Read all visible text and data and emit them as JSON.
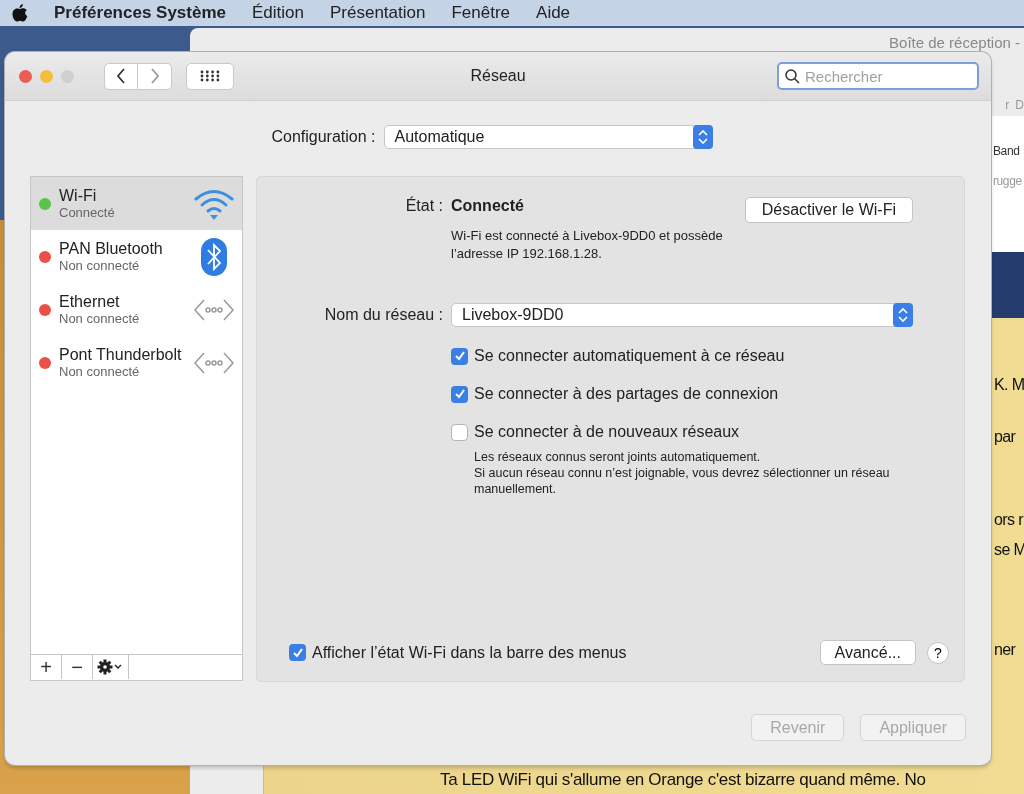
{
  "menu_bar": {
    "app": "Préférences Système",
    "items": [
      "Édition",
      "Présentation",
      "Fenêtre",
      "Aide"
    ]
  },
  "background_window": {
    "title": "Boîte de réception -",
    "toolbar_fragments": [
      "r",
      "D"
    ],
    "list_fragments": [
      "Band",
      "rugge"
    ],
    "message_fragments": [
      "K. M",
      "par",
      "ors r",
      "se M",
      "ner"
    ],
    "message_last_line": "Ta LED WiFi qui s'allume en Orange c'est bizarre quand même. No"
  },
  "window": {
    "title": "Réseau",
    "search": {
      "placeholder": "Rechercher"
    }
  },
  "configuration": {
    "label": "Configuration :",
    "value": "Automatique"
  },
  "services": [
    {
      "name": "Wi-Fi",
      "status": "Connecté",
      "color": "#5ac44a",
      "selected": true,
      "kind": "wifi"
    },
    {
      "name": "PAN Bluetooth",
      "status": "Non connecté",
      "color": "#e9504a",
      "selected": false,
      "kind": "bluetooth"
    },
    {
      "name": "Ethernet",
      "status": "Non connecté",
      "color": "#e9504a",
      "selected": false,
      "kind": "wired"
    },
    {
      "name": "Pont Thunderbolt",
      "status": "Non connecté",
      "color": "#e9504a",
      "selected": false,
      "kind": "wired"
    }
  ],
  "service_toolbar": {
    "add": "+",
    "remove": "−"
  },
  "status": {
    "label": "État :",
    "value": "Connecté",
    "toggle_button": "Désactiver le Wi-Fi",
    "description": "Wi-Fi est connecté à Livebox-9DD0 et possède l’adresse IP 192.168.1.28."
  },
  "network_name": {
    "label": "Nom du réseau :",
    "value": "Livebox-9DD0"
  },
  "options": [
    {
      "label": "Se connecter automatiquement à ce réseau",
      "checked": true
    },
    {
      "label": "Se connecter à des partages de connexion",
      "checked": true
    },
    {
      "label": "Se connecter à de nouveaux réseaux",
      "checked": false
    }
  ],
  "options_note": [
    "Les réseaux connus seront joints automatiquement.",
    "Si aucun réseau connu n’est joignable, vous devrez sélectionner un réseau manuellement."
  ],
  "menu_bar_option": {
    "label": "Afficher l’état Wi-Fi dans la barre des menus",
    "checked": true
  },
  "advanced_button": "Avancé...",
  "help_button": "?",
  "footer_buttons": [
    {
      "label": "Revenir",
      "disabled": true
    },
    {
      "label": "Appliquer",
      "disabled": true
    }
  ]
}
